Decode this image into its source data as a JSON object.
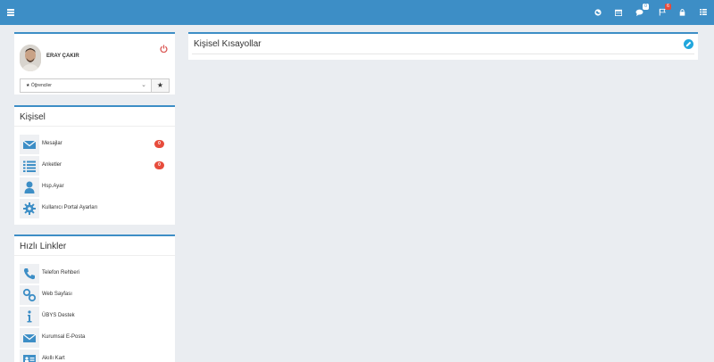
{
  "colors": {
    "topbar": "#3d8ec6",
    "badge_red": "#e74c3c",
    "edit_blue": "#22a7dd",
    "icon_blue": "#3d8ec6"
  },
  "topbar": {
    "icons": [
      "hamburger-icon",
      "globe-icon",
      "calendar-icon",
      "chat-icon",
      "flag-icon",
      "lock-icon",
      "grid-icon"
    ],
    "chat_badge": "0",
    "flag_badge": "6"
  },
  "profile": {
    "name": "ERAY ÇAKIR",
    "role_selected": "★ Öğrenciler"
  },
  "kisisel": {
    "title": "Kişisel",
    "items": [
      {
        "label": "Mesajlar",
        "icon": "envelope-icon",
        "badge": "0"
      },
      {
        "label": "Anketler",
        "icon": "list-icon",
        "badge": "0"
      },
      {
        "label": "Hsp.Ayar",
        "icon": "user-icon"
      },
      {
        "label": "Kullanıcı Portal Ayarları",
        "icon": "gear-icon"
      }
    ]
  },
  "hizli": {
    "title": "Hızlı Linkler",
    "items": [
      {
        "label": "Telefon Rehberi",
        "icon": "phone-icon"
      },
      {
        "label": "Web Sayfası",
        "icon": "link-icon"
      },
      {
        "label": "ÜBYS Destek",
        "icon": "info-icon"
      },
      {
        "label": "Kurumsal E-Posta",
        "icon": "envelope-icon"
      },
      {
        "label": "Akıllı Kart",
        "icon": "id-card-icon"
      }
    ]
  },
  "shortcuts": {
    "title": "Kişisel Kısayollar"
  }
}
